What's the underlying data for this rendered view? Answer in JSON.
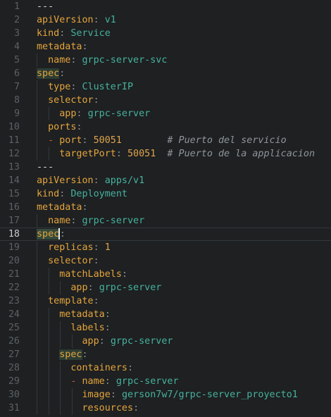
{
  "editor": {
    "active_line": 18,
    "lines": [
      {
        "n": "1",
        "i": 0,
        "seg": [
          [
            "sep",
            "---"
          ]
        ]
      },
      {
        "n": "2",
        "i": 0,
        "seg": [
          [
            "key",
            "apiVersion"
          ],
          [
            "punc",
            ": "
          ],
          [
            "str",
            "v1"
          ]
        ]
      },
      {
        "n": "3",
        "i": 0,
        "seg": [
          [
            "key",
            "kind"
          ],
          [
            "punc",
            ": "
          ],
          [
            "str",
            "Service"
          ]
        ]
      },
      {
        "n": "4",
        "i": 0,
        "seg": [
          [
            "key",
            "metadata"
          ],
          [
            "punc",
            ":"
          ]
        ]
      },
      {
        "n": "5",
        "i": 1,
        "seg": [
          [
            "key",
            "name"
          ],
          [
            "punc",
            ": "
          ],
          [
            "str",
            "grpc-server-svc"
          ]
        ]
      },
      {
        "n": "6",
        "i": 0,
        "seg": [
          [
            "key hl",
            "spec"
          ],
          [
            "punc",
            ":"
          ]
        ]
      },
      {
        "n": "7",
        "i": 1,
        "seg": [
          [
            "key",
            "type"
          ],
          [
            "punc",
            ": "
          ],
          [
            "str",
            "ClusterIP"
          ]
        ]
      },
      {
        "n": "8",
        "i": 1,
        "seg": [
          [
            "key",
            "selector"
          ],
          [
            "punc",
            ":"
          ]
        ]
      },
      {
        "n": "9",
        "i": 2,
        "seg": [
          [
            "key",
            "app"
          ],
          [
            "punc",
            ": "
          ],
          [
            "str",
            "grpc-server"
          ]
        ]
      },
      {
        "n": "10",
        "i": 1,
        "seg": [
          [
            "key",
            "ports"
          ],
          [
            "punc",
            ":"
          ]
        ]
      },
      {
        "n": "11",
        "i": 1,
        "seg": [
          [
            "dash",
            "- "
          ],
          [
            "key",
            "port"
          ],
          [
            "punc",
            ": "
          ],
          [
            "num",
            "50051"
          ],
          [
            "cmt",
            "        # Puerto del servicio"
          ]
        ]
      },
      {
        "n": "12",
        "i": 2,
        "seg": [
          [
            "key",
            "targetPort"
          ],
          [
            "punc",
            ": "
          ],
          [
            "num",
            "50051"
          ],
          [
            "cmt",
            "  # Puerto de la applicacion"
          ]
        ]
      },
      {
        "n": "13",
        "i": 0,
        "seg": [
          [
            "sep",
            "---"
          ]
        ]
      },
      {
        "n": "14",
        "i": 0,
        "seg": [
          [
            "key",
            "apiVersion"
          ],
          [
            "punc",
            ": "
          ],
          [
            "str",
            "apps/v1"
          ]
        ]
      },
      {
        "n": "15",
        "i": 0,
        "seg": [
          [
            "key",
            "kind"
          ],
          [
            "punc",
            ": "
          ],
          [
            "str",
            "Deployment"
          ]
        ]
      },
      {
        "n": "16",
        "i": 0,
        "seg": [
          [
            "key",
            "metadata"
          ],
          [
            "punc",
            ":"
          ]
        ]
      },
      {
        "n": "17",
        "i": 1,
        "seg": [
          [
            "key",
            "name"
          ],
          [
            "punc",
            ": "
          ],
          [
            "str",
            "grpc-server"
          ]
        ]
      },
      {
        "n": "18",
        "i": 0,
        "seg": [
          [
            "key hl-strong",
            "spec"
          ],
          [
            "cursor",
            ""
          ],
          [
            "punc",
            ":"
          ]
        ]
      },
      {
        "n": "19",
        "i": 1,
        "seg": [
          [
            "key",
            "replicas"
          ],
          [
            "punc",
            ": "
          ],
          [
            "num",
            "1"
          ]
        ]
      },
      {
        "n": "20",
        "i": 1,
        "seg": [
          [
            "key",
            "selector"
          ],
          [
            "punc",
            ":"
          ]
        ]
      },
      {
        "n": "21",
        "i": 2,
        "seg": [
          [
            "key",
            "matchLabels"
          ],
          [
            "punc",
            ":"
          ]
        ]
      },
      {
        "n": "22",
        "i": 3,
        "seg": [
          [
            "key",
            "app"
          ],
          [
            "punc",
            ": "
          ],
          [
            "str",
            "grpc-server"
          ]
        ]
      },
      {
        "n": "23",
        "i": 1,
        "seg": [
          [
            "key",
            "template"
          ],
          [
            "punc",
            ":"
          ]
        ]
      },
      {
        "n": "24",
        "i": 2,
        "seg": [
          [
            "key",
            "metadata"
          ],
          [
            "punc",
            ":"
          ]
        ]
      },
      {
        "n": "25",
        "i": 3,
        "seg": [
          [
            "key",
            "labels"
          ],
          [
            "punc",
            ":"
          ]
        ]
      },
      {
        "n": "26",
        "i": 4,
        "seg": [
          [
            "key",
            "app"
          ],
          [
            "punc",
            ": "
          ],
          [
            "str",
            "grpc-server"
          ]
        ]
      },
      {
        "n": "27",
        "i": 2,
        "seg": [
          [
            "key hl",
            "spec"
          ],
          [
            "punc",
            ":"
          ]
        ]
      },
      {
        "n": "28",
        "i": 3,
        "seg": [
          [
            "key",
            "containers"
          ],
          [
            "punc",
            ":"
          ]
        ]
      },
      {
        "n": "29",
        "i": 3,
        "seg": [
          [
            "dash",
            "- "
          ],
          [
            "key",
            "name"
          ],
          [
            "punc",
            ": "
          ],
          [
            "str",
            "grpc-server"
          ]
        ]
      },
      {
        "n": "30",
        "i": 4,
        "seg": [
          [
            "key",
            "image"
          ],
          [
            "punc",
            ": "
          ],
          [
            "str",
            "gerson7w7/grpc-server_proyecto1"
          ]
        ]
      },
      {
        "n": "31",
        "i": 4,
        "seg": [
          [
            "key",
            "resources"
          ],
          [
            "punc",
            ":"
          ]
        ]
      }
    ]
  }
}
